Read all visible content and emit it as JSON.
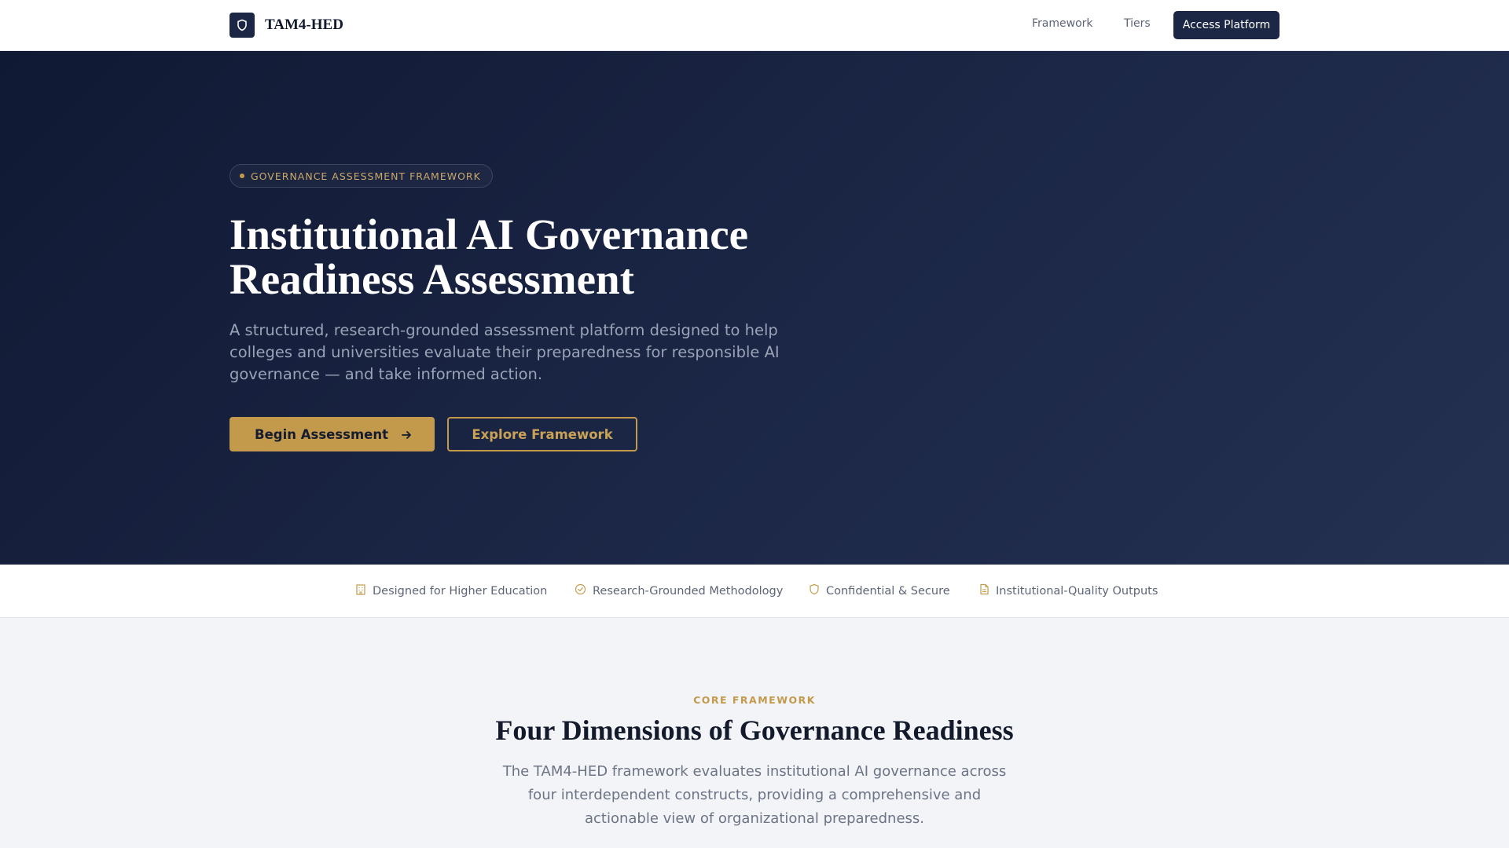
{
  "brand": {
    "name": "TAM4-HED",
    "icon": "shield-icon"
  },
  "nav": {
    "links": [
      "Framework",
      "Tiers"
    ],
    "cta": "Access Platform"
  },
  "hero": {
    "badge": "GOVERNANCE ASSESSMENT FRAMEWORK",
    "title_line1": "Institutional AI Governance",
    "title_line2": "Readiness Assessment",
    "subtitle": "A structured, research-grounded assessment platform designed to help colleges and universities evaluate their preparedness for responsible AI governance — and take informed action.",
    "primary_button": "Begin Assessment",
    "primary_button_icon": "arrow-right-icon",
    "secondary_button": "Explore Framework"
  },
  "trust": [
    {
      "label": "Designed for Higher Education",
      "icon": "building-icon"
    },
    {
      "label": "Research-Grounded Methodology",
      "icon": "check-circle-icon"
    },
    {
      "label": "Confidential & Secure",
      "icon": "shield-icon"
    },
    {
      "label": "Institutional-Quality Outputs",
      "icon": "document-icon"
    }
  ],
  "framework": {
    "eyebrow": "CORE FRAMEWORK",
    "title": "Four Dimensions of Governance Readiness",
    "subtitle": "The TAM4-HED framework evaluates institutional AI governance across four interdependent constructs, providing a comprehensive and actionable view of organizational preparedness."
  },
  "colors": {
    "navy": "#1b2744",
    "gold": "#c39a4b",
    "hero_gradient_start": "#101933",
    "hero_gradient_end": "#243150"
  }
}
